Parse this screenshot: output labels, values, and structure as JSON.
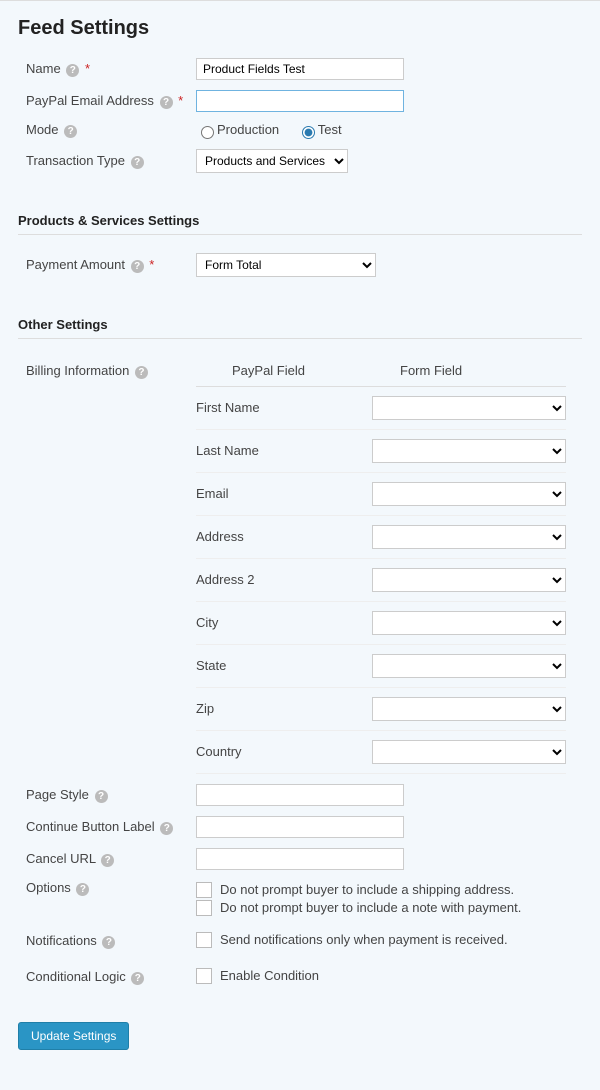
{
  "title": "Feed Settings",
  "feed": {
    "name_label": "Name",
    "name_value": "Product Fields Test",
    "email_label": "PayPal Email Address",
    "email_value": "",
    "mode_label": "Mode",
    "mode_production": "Production",
    "mode_test": "Test",
    "txn_label": "Transaction Type",
    "txn_value": "Products and Services"
  },
  "products_section": "Products & Services Settings",
  "payment": {
    "label": "Payment Amount",
    "value": "Form Total"
  },
  "other_section": "Other Settings",
  "billing": {
    "label": "Billing Information",
    "col_paypal": "PayPal Field",
    "col_form": "Form Field",
    "rows": [
      "First Name",
      "Last Name",
      "Email",
      "Address",
      "Address 2",
      "City",
      "State",
      "Zip",
      "Country"
    ]
  },
  "page_style_label": "Page Style",
  "continue_label": "Continue Button Label",
  "cancel_label": "Cancel URL",
  "options": {
    "label": "Options",
    "ship": "Do not prompt buyer to include a shipping address.",
    "note": "Do not prompt buyer to include a note with payment."
  },
  "notifications": {
    "label": "Notifications",
    "text": "Send notifications only when payment is received."
  },
  "conditional": {
    "label": "Conditional Logic",
    "text": "Enable Condition"
  },
  "button": "Update Settings"
}
